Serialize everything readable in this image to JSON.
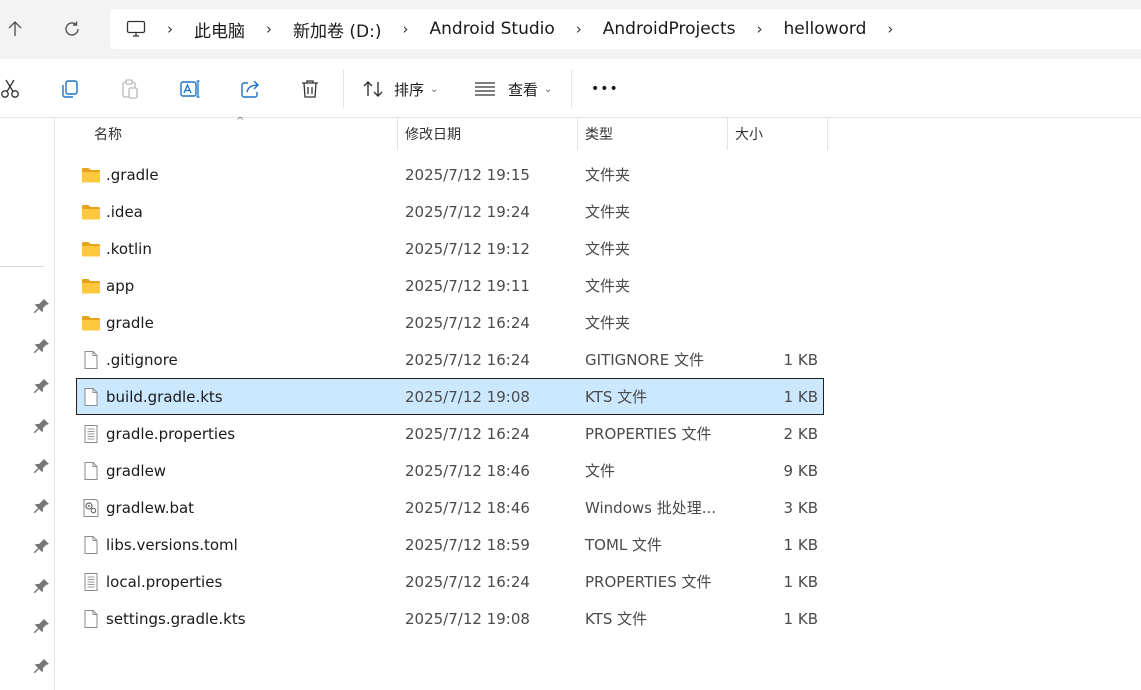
{
  "breadcrumb": [
    "此电脑",
    "新加卷 (D:)",
    "Android Studio",
    "AndroidProjects",
    "helloword"
  ],
  "toolbar": {
    "sort_label": "排序",
    "view_label": "查看",
    "more_label": "•••"
  },
  "columns": {
    "name": "名称",
    "date": "修改日期",
    "type": "类型",
    "size": "大小"
  },
  "files": [
    {
      "name": ".gradle",
      "date": "2025/7/12 19:15",
      "type": "文件夹",
      "size": "",
      "icon": "folder-icon"
    },
    {
      "name": ".idea",
      "date": "2025/7/12 19:24",
      "type": "文件夹",
      "size": "",
      "icon": "folder-icon"
    },
    {
      "name": ".kotlin",
      "date": "2025/7/12 19:12",
      "type": "文件夹",
      "size": "",
      "icon": "folder-icon"
    },
    {
      "name": "app",
      "date": "2025/7/12 19:11",
      "type": "文件夹",
      "size": "",
      "icon": "folder-icon"
    },
    {
      "name": "gradle",
      "date": "2025/7/12 16:24",
      "type": "文件夹",
      "size": "",
      "icon": "folder-icon"
    },
    {
      "name": ".gitignore",
      "date": "2025/7/12 16:24",
      "type": "GITIGNORE 文件",
      "size": "1 KB",
      "icon": "file-icon"
    },
    {
      "name": "build.gradle.kts",
      "date": "2025/7/12 19:08",
      "type": "KTS 文件",
      "size": "1 KB",
      "icon": "file-icon",
      "selected": true
    },
    {
      "name": "gradle.properties",
      "date": "2025/7/12 16:24",
      "type": "PROPERTIES 文件",
      "size": "2 KB",
      "icon": "text-file-icon"
    },
    {
      "name": "gradlew",
      "date": "2025/7/12 18:46",
      "type": "文件",
      "size": "9 KB",
      "icon": "file-icon"
    },
    {
      "name": "gradlew.bat",
      "date": "2025/7/12 18:46",
      "type": "Windows 批处理...",
      "size": "3 KB",
      "icon": "batch-file-icon"
    },
    {
      "name": "libs.versions.toml",
      "date": "2025/7/12 18:59",
      "type": "TOML 文件",
      "size": "1 KB",
      "icon": "file-icon"
    },
    {
      "name": "local.properties",
      "date": "2025/7/12 16:24",
      "type": "PROPERTIES 文件",
      "size": "1 KB",
      "icon": "text-file-icon"
    },
    {
      "name": "settings.gradle.kts",
      "date": "2025/7/12 19:08",
      "type": "KTS 文件",
      "size": "1 KB",
      "icon": "file-icon"
    }
  ],
  "colors": {
    "selection_bg": "#cce8ff",
    "folder_yellow": "#ffc83d",
    "addressbar_bg": "#f3f3f3"
  }
}
